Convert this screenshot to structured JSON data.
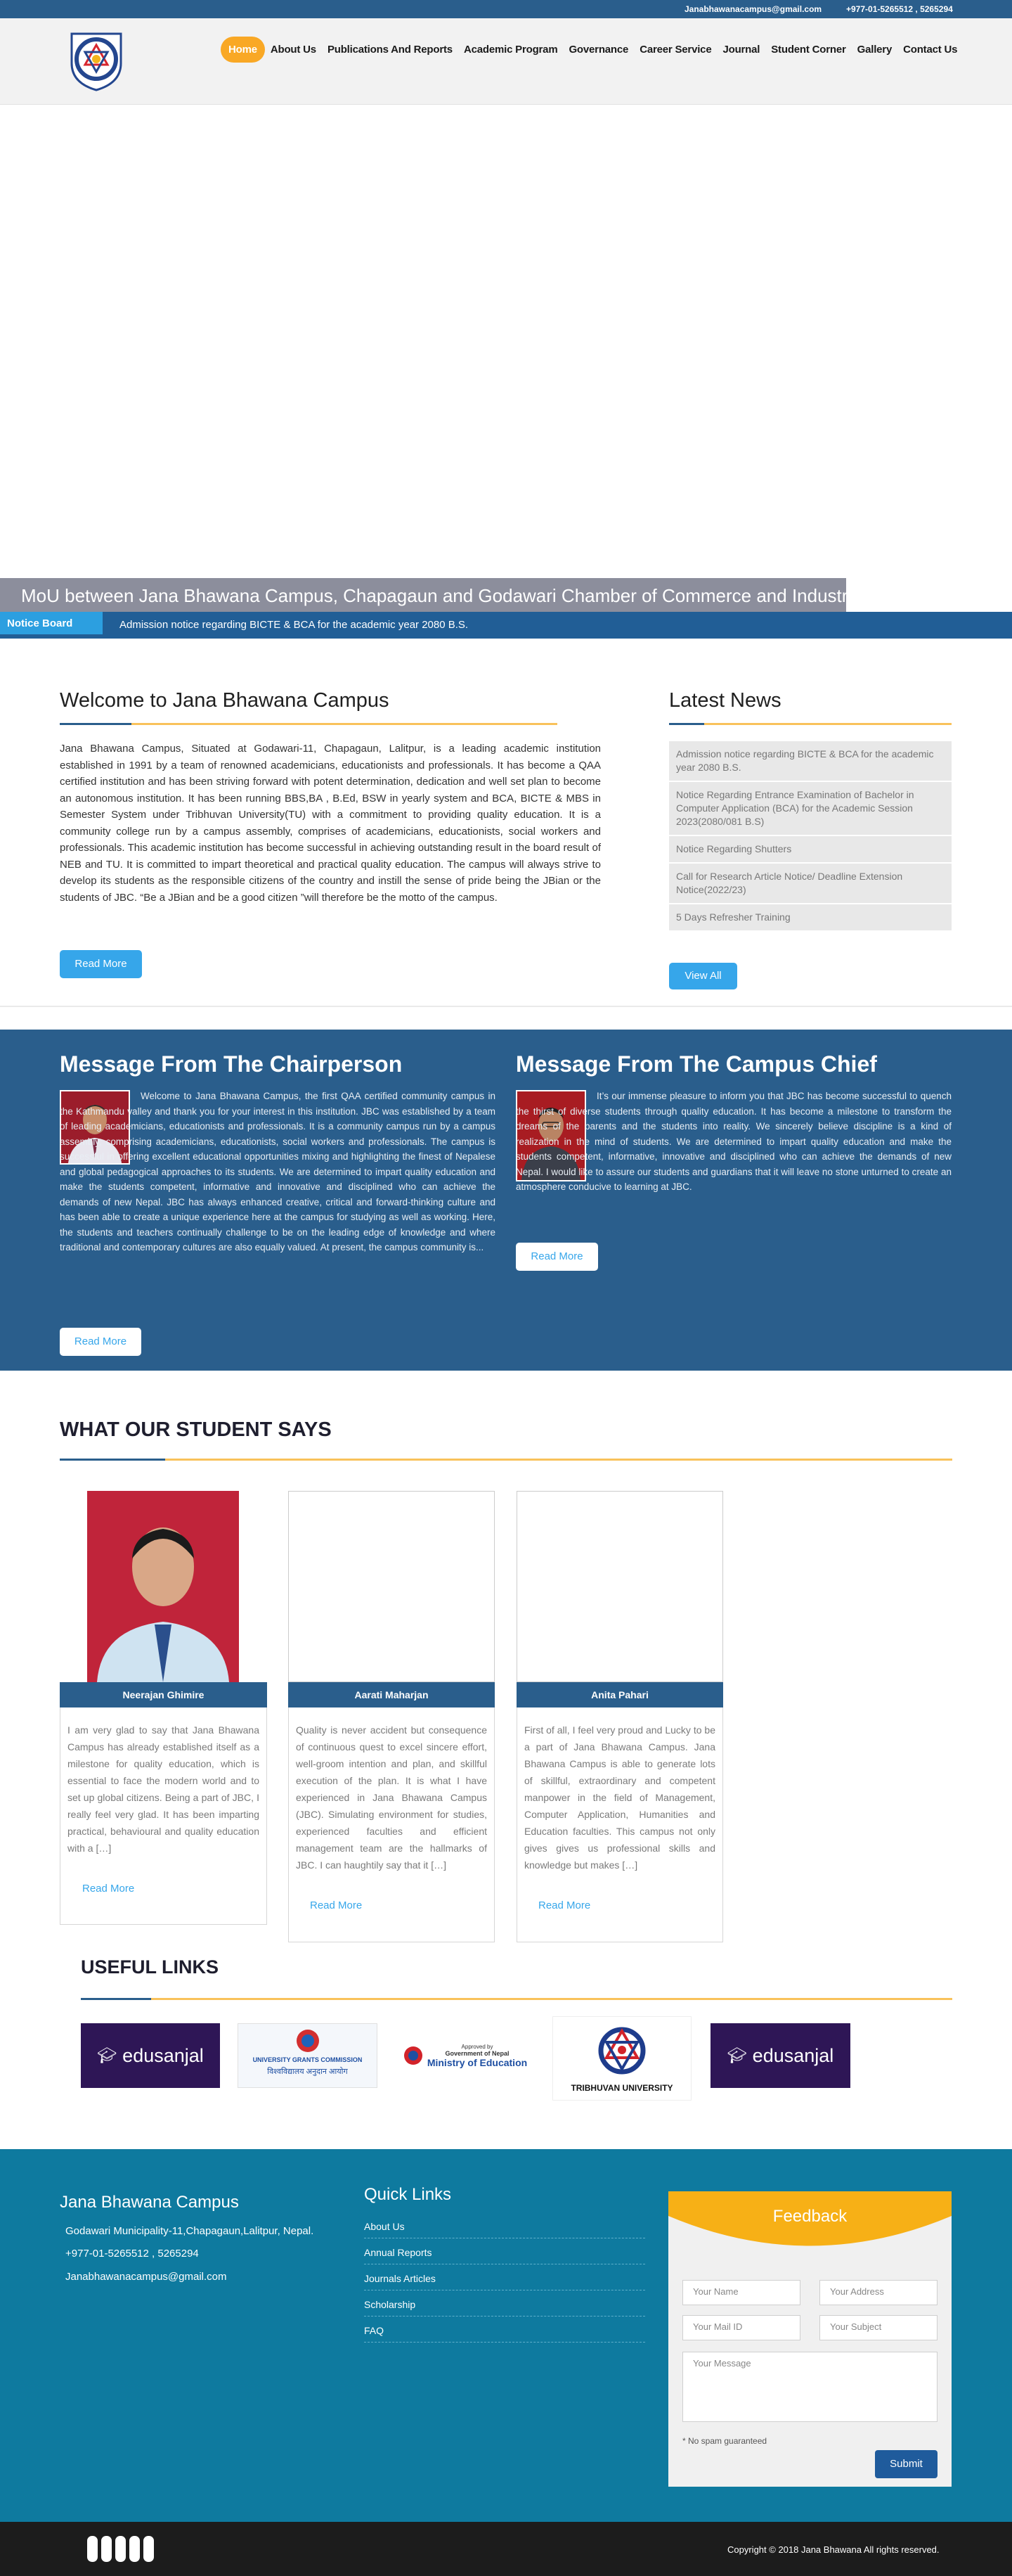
{
  "topbar": {
    "email": "Janabhawanacampus@gmail.com",
    "phone": "+977-01-5265512 , 5265294"
  },
  "nav": [
    "Home",
    "About Us",
    "Publications And Reports",
    "Academic Program",
    "Governance",
    "Career Service",
    "Journal",
    "Student Corner",
    "Gallery",
    "Contact Us"
  ],
  "banner": {
    "caption": "MoU between Jana Bhawana Campus, Chapagaun and Godawari Chamber of Commerce and Industry"
  },
  "notice": {
    "label": "Notice Board",
    "text": "Admission notice regarding BICTE & BCA for the academic year 2080 B.S."
  },
  "welcome": {
    "title": "Welcome to Jana Bhawana Campus",
    "body": "Jana Bhawana Campus, Situated at Godawari-11, Chapagaun, Lalitpur, is a leading academic institution established in 1991 by a team of renowned academicians, educationists and professionals. It has  become a QAA certified institution and has been striving forward with potent determination, dedication and well set plan to become an autonomous institution.  It has been running BBS,BA , B.Ed, BSW in yearly system and BCA, BICTE & MBS in Semester System under Tribhuvan University(TU) with a commitment to providing quality education. It is a community college run by a campus assembly, comprises of academicians, educationists, social workers and professionals. This academic institution has become successful in achieving outstanding result in the board result of NEB and TU. It is committed to impart theoretical and practical quality education. The campus will always strive to develop its students as the responsible citizens of the country and instill the sense of pride being the JBian or the students of JBC. “Be a JBian and be a good citizen ”will therefore be the motto of the campus.",
    "read_more": "Read More"
  },
  "news": {
    "title": "Latest News",
    "items": [
      "Admission notice regarding BICTE & BCA for the academic year 2080 B.S.",
      "Notice Regarding Entrance Examination of Bachelor in Computer Application (BCA) for the Academic Session 2023(2080/081 B.S)",
      "Notice Regarding Shutters",
      "Call for Research Article Notice/ Deadline Extension Notice(2022/23)",
      "5 Days Refresher Training"
    ],
    "view_all": "View All"
  },
  "chair": {
    "title": "Message From The Chairperson",
    "body": "Welcome to Jana Bhawana Campus, the first QAA certified community campus in the Kathmandu valley and thank you for your interest in this institution. JBC was established by a team of leading academicians, educationists and professionals. It is a community campus run by a campus assembly, comprising academicians, educationists, social workers and professionals. The campus is successful in offering excellent educational opportunities mixing and highlighting the finest of Nepalese and global pedagogical approaches to its students. We are determined to impart quality education and make the students competent, informative and innovative and disciplined who can achieve the demands of new Nepal. JBC has always enhanced creative, critical and forward-thinking culture and has been able to create a unique experience here at the campus for studying as well as working. Here, the students and teachers continually challenge to be on the leading edge of knowledge and where traditional and contemporary cultures are also equally valued. At present, the campus community is...",
    "read_more": "Read More"
  },
  "chief": {
    "title": "Message From The Campus Chief",
    "body": "It’s our immense pleasure to inform you that JBC has become successful to quench the thirst of diverse students through quality education. It has become a milestone to transform the dreams of the parents and the students into reality. We sincerely believe discipline is a kind of realization in the mind of students. We are determined to impart quality education and make the students competent, informative, innovative and disciplined who can achieve the demands of new Nepal. I would like to assure our students and guardians that it will leave no stone unturned to create an atmosphere conducive to learning at JBC.",
    "read_more": "Read More"
  },
  "students": {
    "title": "WHAT OUR STUDENT SAYS",
    "items": [
      {
        "name": "Neerajan Ghimire",
        "text": "I am very glad to say that Jana Bhawana Campus has already established itself as a milestone for quality education, which is essential to face the modern world and to set up global citizens. Being a part of JBC, I really feel very glad. It has been imparting practical, behavioural and quality education with a […]",
        "more": "Read More"
      },
      {
        "name": "Aarati Maharjan",
        "text": "Quality is never accident but consequence of continuous quest to excel sincere effort, well-groom intention and plan, and skillful execution of the plan. It is what I have experienced in Jana Bhawana Campus (JBC). Simulating environment for studies, experienced faculties and efficient management team are the hallmarks of JBC. I can haughtily say that it […]",
        "more": "Read More"
      },
      {
        "name": "Anita Pahari",
        "text": "First of all, I feel very proud and Lucky to be a part of Jana Bhawana Campus. Jana Bhawana Campus is able to generate lots of skillful, extraordinary and competent manpower in the field of Management, Computer Application, Humanities and Education faculties. This campus not only gives gives us professional skills and knowledge but makes […]",
        "more": "Read More"
      }
    ]
  },
  "links": {
    "title": "USEFUL LINKS",
    "edusanjal": "edusanjal",
    "ugc_en": "UNIVERSITY GRANTS COMMISSION",
    "ugc_np": "विश्वविद्यालय अनुदान आयोग",
    "moe_approved": "Approved by",
    "moe_gov": "Government of Nepal",
    "moe_name": "Ministry of Education",
    "tu": "TRIBHUVAN UNIVERSITY"
  },
  "footer": {
    "title": "Jana Bhawana Campus",
    "address": "Godawari Municipality-11,Chapagaun,Lalitpur, Nepal.",
    "phone": "+977-01-5265512 , 5265294",
    "email": "Janabhawanacampus@gmail.com",
    "quick_title": "Quick Links",
    "quick": [
      "About Us",
      "Annual Reports",
      "Journals Articles",
      "Scholarship",
      "FAQ"
    ],
    "feedback": {
      "title": "Feedback",
      "name": "Your Name",
      "address": "Your Address",
      "mail": "Your Mail ID",
      "subject": "Your Subject",
      "message": "Your Message",
      "spam": "* No spam guaranteed",
      "submit": "Submit"
    },
    "copyright": "Copyright © 2018 Jana Bhawana All rights reserved."
  },
  "colors": {
    "primary": "#2a5e8c",
    "accent": "#f9a825",
    "link": "#36a6ea",
    "footer": "#0e7a9f"
  }
}
